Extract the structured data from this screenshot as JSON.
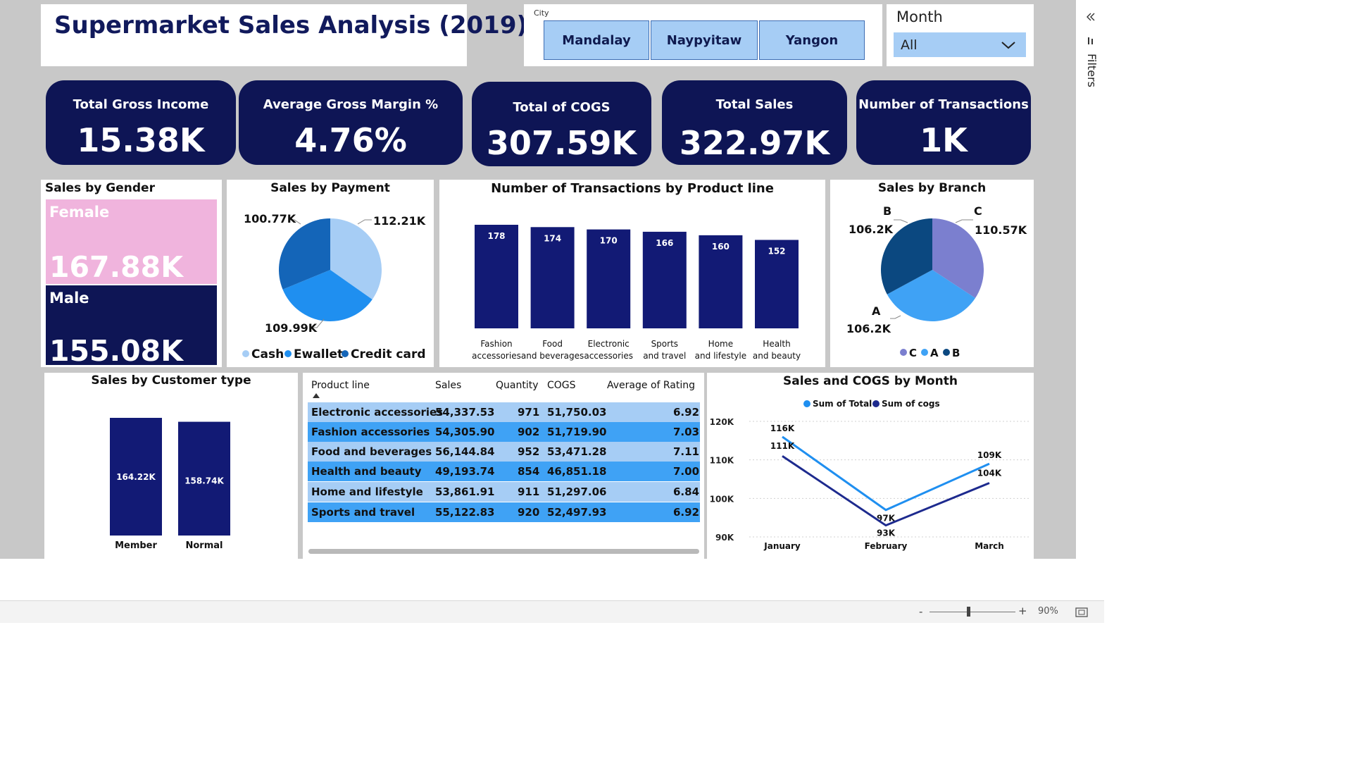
{
  "title": "Supermarket Sales Analysis (2019)",
  "city_slicer": {
    "label": "City",
    "options": [
      "Mandalay",
      "Naypyitaw",
      "Yangon"
    ]
  },
  "month_slicer": {
    "label": "Month",
    "value": "All"
  },
  "kpis": [
    {
      "label": "Total Gross Income",
      "value": "15.38K"
    },
    {
      "label": "Average Gross Margin %",
      "value": "4.76%"
    },
    {
      "label": "Total of COGS",
      "value": "307.59K"
    },
    {
      "label": "Total Sales",
      "value": "322.97K"
    },
    {
      "label": "Number of Transactions",
      "value": "1K"
    }
  ],
  "gender": {
    "title": "Sales by Gender",
    "female_label": "Female",
    "female_value": "167.88K",
    "male_label": "Male",
    "male_value": "155.08K"
  },
  "payment": {
    "title": "Sales by Payment",
    "labels": [
      "112.21K",
      "109.99K",
      "100.77K"
    ],
    "legend": [
      "Cash",
      "Ewallet",
      "Credit card"
    ]
  },
  "product_tx": {
    "title": "Number of Transactions by Product line"
  },
  "branch": {
    "title": "Sales by Branch",
    "slices": [
      {
        "name": "C",
        "value_label": "110.57K"
      },
      {
        "name": "A",
        "value_label": "106.2K"
      },
      {
        "name": "B",
        "value_label": "106.2K"
      }
    ],
    "legend": [
      "C",
      "A",
      "B"
    ]
  },
  "customer": {
    "title": "Sales by Customer type"
  },
  "table": {
    "headers": [
      "Product line",
      "Sales",
      "Quantity",
      "COGS",
      "Average of Rating"
    ],
    "rows": [
      [
        "Electronic accessories",
        "54,337.53",
        "971",
        "51,750.03",
        "6.92"
      ],
      [
        "Fashion accessories",
        "54,305.90",
        "902",
        "51,719.90",
        "7.03"
      ],
      [
        "Food and beverages",
        "56,144.84",
        "952",
        "53,471.28",
        "7.11"
      ],
      [
        "Health and beauty",
        "49,193.74",
        "854",
        "46,851.18",
        "7.00"
      ],
      [
        "Home and lifestyle",
        "53,861.91",
        "911",
        "51,297.06",
        "6.84"
      ],
      [
        "Sports and travel",
        "55,122.83",
        "920",
        "52,497.93",
        "6.92"
      ]
    ]
  },
  "monthly": {
    "title": "Sales and COGS by Month"
  },
  "status": {
    "zoom": "90%"
  },
  "sidebar": {
    "filters_label": "Filters"
  },
  "colors": {
    "navy": "#0e1555",
    "bar": "#121a75",
    "light_blue": "#a6cdf5",
    "mid_blue": "#1f8ff0",
    "dark_blue": "#1465b8",
    "female_pink": "#f0b4dd"
  },
  "chart_data": [
    {
      "type": "pie",
      "title": "Sales by Payment",
      "categories": [
        "Cash",
        "Ewallet",
        "Credit card"
      ],
      "values": [
        112.21,
        109.99,
        100.77
      ],
      "value_labels": [
        "112.21K",
        "109.99K",
        "100.77K"
      ],
      "legend": "bottom"
    },
    {
      "type": "bar",
      "title": "Number of Transactions by Product line",
      "categories": [
        "Fashion accessories",
        "Food and beverages",
        "Electronic accessories",
        "Sports and travel",
        "Home and lifestyle",
        "Health and beauty"
      ],
      "values": [
        178,
        174,
        170,
        166,
        160,
        152
      ]
    },
    {
      "type": "pie",
      "title": "Sales by Branch",
      "categories": [
        "C",
        "A",
        "B"
      ],
      "values": [
        110.57,
        106.2,
        106.2
      ],
      "value_labels": [
        "110.57K",
        "106.2K",
        "106.2K"
      ],
      "legend": "bottom"
    },
    {
      "type": "bar",
      "title": "Sales by Customer type",
      "categories": [
        "Member",
        "Normal"
      ],
      "values": [
        164.22,
        158.74
      ],
      "value_labels": [
        "164.22K",
        "158.74K"
      ]
    },
    {
      "type": "line",
      "title": "Sales and COGS by Month",
      "categories": [
        "January",
        "February",
        "March"
      ],
      "series": [
        {
          "name": "Sum of Total",
          "values": [
            116,
            97,
            109
          ],
          "value_labels": [
            "116K",
            "97K",
            "109K"
          ]
        },
        {
          "name": "Sum of cogs",
          "values": [
            111,
            93,
            104
          ],
          "value_labels": [
            "111K",
            "93K",
            "104K"
          ]
        }
      ],
      "y_ticks": [
        "120K",
        "110K",
        "100K",
        "90K"
      ],
      "ylim": [
        90,
        120
      ],
      "legend": "top"
    }
  ]
}
